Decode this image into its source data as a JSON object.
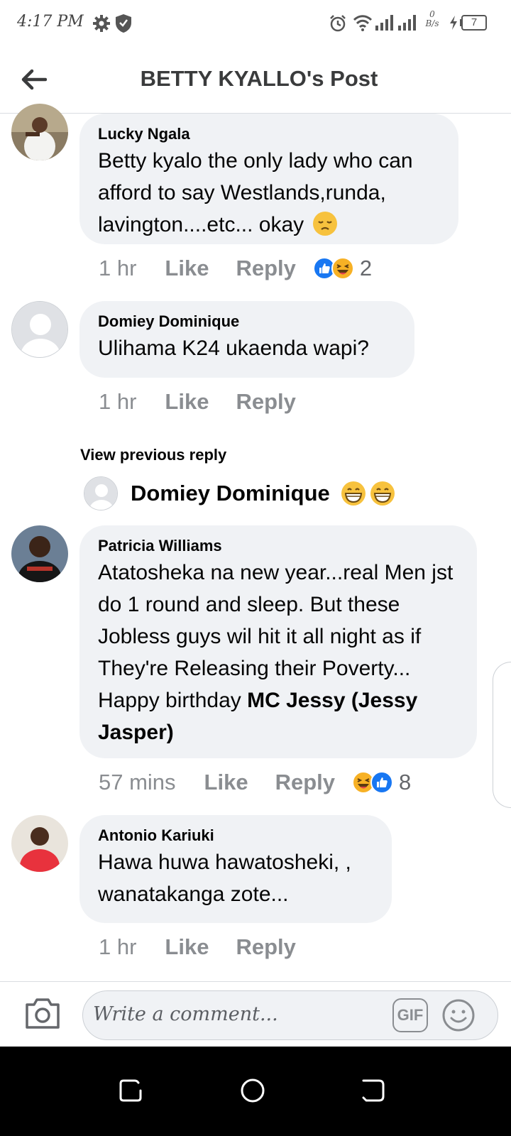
{
  "status_bar": {
    "time": "4:17 PM",
    "data_speed_top": "0",
    "data_speed_bottom": "B/s",
    "battery": "7",
    "icons": [
      "settings-gear-icon",
      "shield-icon",
      "alarm-icon",
      "wifi-icon",
      "signal-icon",
      "signal-icon",
      "charging-icon",
      "battery-icon"
    ]
  },
  "header": {
    "title": "BETTY KYALLO's Post",
    "back_icon": "arrow-left-icon"
  },
  "comments": [
    {
      "name": "Lucky Ngala",
      "text": "Betty kyalo the only lady who can afford to say Westlands,runda, lavington....etc... okay",
      "trailing_emoji": "pensive-face-emoji",
      "time": "1 hr",
      "like": "Like",
      "reply": "Reply",
      "reactions": [
        "like",
        "haha"
      ],
      "reaction_count": "2"
    },
    {
      "name": "Domiey Dominique",
      "text": "Ulihama K24 ukaenda wapi?",
      "time": "1 hr",
      "like": "Like",
      "reply": "Reply"
    },
    {
      "name": "Patricia Williams",
      "text": "Atatosheka na new year...real Men jst do 1 round and sleep. But these Jobless guys wil hit it all night as if They're Releasing their Poverty... Happy birthday ",
      "tag": "MC Jessy (Jessy Jasper)",
      "time": "57 mins",
      "like": "Like",
      "reply": "Reply",
      "reactions": [
        "haha",
        "like"
      ],
      "reaction_count": "8"
    },
    {
      "name": "Antonio Kariuki",
      "text": "Hawa huwa hawatosheki, , wanatakanga zote...",
      "time": "1 hr",
      "like": "Like",
      "reply": "Reply"
    }
  ],
  "replies": {
    "view_previous": "View previous reply",
    "last_reply_name": "Domiey Dominique",
    "last_reply_emojis": [
      "grinning-face-emoji",
      "grinning-face-emoji"
    ]
  },
  "composer": {
    "placeholder": "Write a comment...",
    "gif_label": "GIF",
    "camera_icon": "camera-icon",
    "emoji_icon": "smiley-icon"
  },
  "navigation_bar": {
    "buttons": [
      "recent-apps-icon",
      "home-icon",
      "back-icon"
    ]
  },
  "colors": {
    "bubble": "#f0f2f5",
    "meta_text": "#8a8d91",
    "like_blue": "#1877f2",
    "haha_yellow": "#f7b125"
  }
}
